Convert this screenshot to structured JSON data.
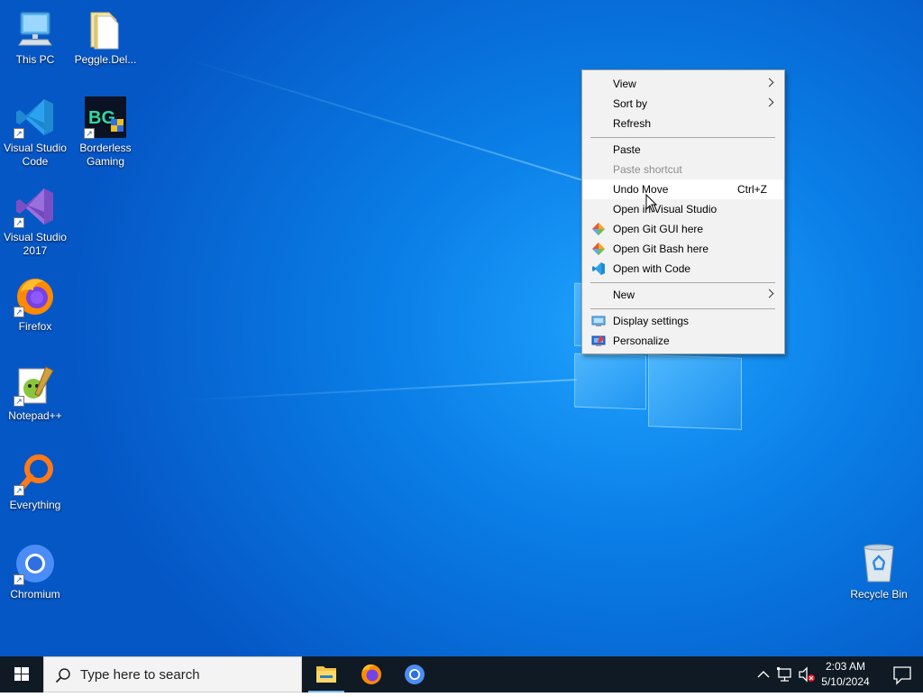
{
  "desktop_icons": [
    {
      "label": "This PC"
    },
    {
      "label": "Peggle.Del..."
    },
    {
      "label": "Visual Studio Code"
    },
    {
      "label": "Borderless Gaming"
    },
    {
      "label": "Visual Studio 2017"
    },
    {
      "label": "Firefox"
    },
    {
      "label": "Notepad++"
    },
    {
      "label": "Everything"
    },
    {
      "label": "Chromium"
    },
    {
      "label": "Recycle Bin"
    }
  ],
  "context_menu": {
    "items": [
      {
        "label": "View",
        "submenu": true
      },
      {
        "label": "Sort by",
        "submenu": true
      },
      {
        "label": "Refresh"
      },
      {
        "label": "Paste"
      },
      {
        "label": "Paste shortcut",
        "disabled": true
      },
      {
        "label": "Undo Move",
        "shortcut": "Ctrl+Z",
        "hovered": true
      },
      {
        "label": "Open in Visual Studio"
      },
      {
        "label": "Open Git GUI here",
        "icon": "git-gui-icon"
      },
      {
        "label": "Open Git Bash here",
        "icon": "git-bash-icon"
      },
      {
        "label": "Open with Code",
        "icon": "vscode-icon"
      },
      {
        "label": "New",
        "submenu": true
      },
      {
        "label": "Display settings",
        "icon": "display-icon"
      },
      {
        "label": "Personalize",
        "icon": "personalize-icon"
      }
    ]
  },
  "taskbar": {
    "search_placeholder": "Type here to search",
    "pinned": [
      "file-explorer-icon",
      "firefox-icon",
      "chromium-icon"
    ],
    "clock_time": "2:03 AM",
    "clock_date": "5/10/2024"
  },
  "colors": {
    "desktop_blue": "#0a7ee6",
    "taskbar": "#0f1a24",
    "menu_bg": "#f2f2f2",
    "menu_disabled": "#8d8d8d"
  }
}
